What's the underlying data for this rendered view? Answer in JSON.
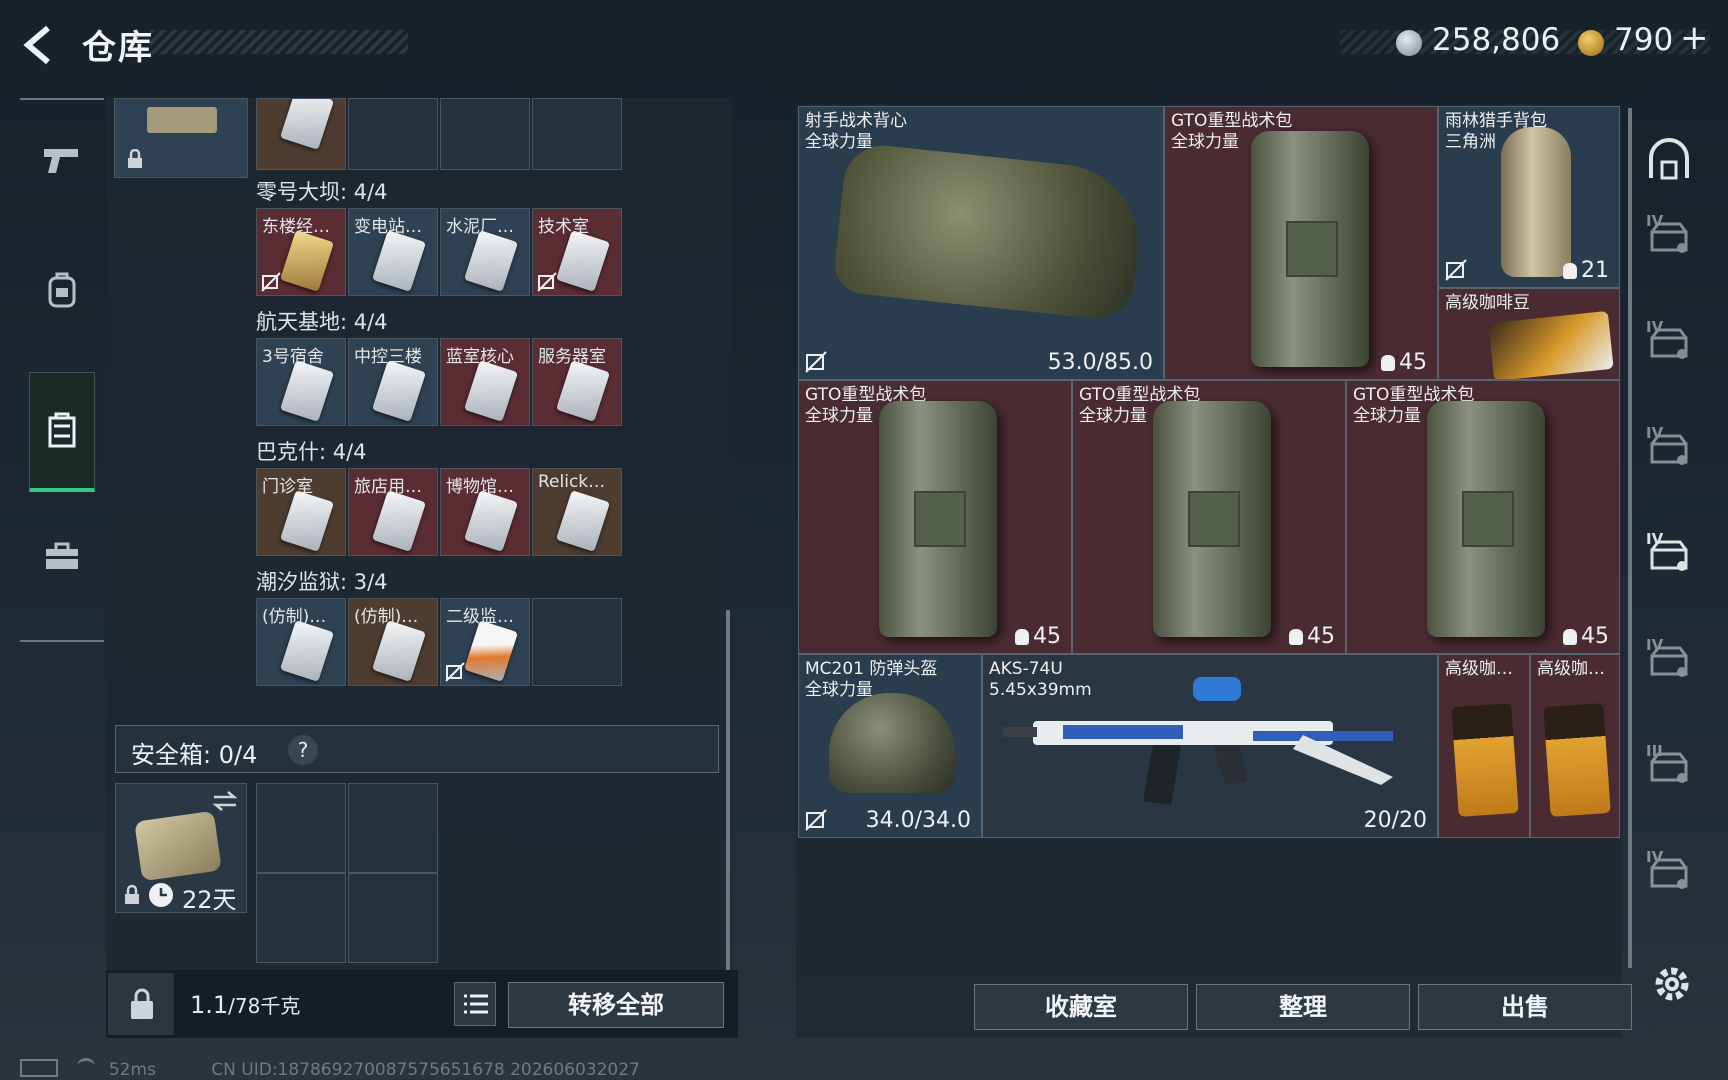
{
  "header": {
    "title": "仓库",
    "money": "258,806",
    "bonds": "790",
    "plus": "+"
  },
  "left_rail": {
    "items": [
      "weapon-tab",
      "backpack-tab",
      "container-tab",
      "toolbox-tab"
    ],
    "active": "container-tab"
  },
  "keys": {
    "groups": [
      {
        "title": "零号大坝: 4/4",
        "slots": [
          {
            "label": "东楼经…",
            "color": "red",
            "card": "gold",
            "nobind": true
          },
          {
            "label": "变电站…",
            "color": "blue",
            "card": "white",
            "nobind": false
          },
          {
            "label": "水泥厂…",
            "color": "blue",
            "card": "white",
            "nobind": false
          },
          {
            "label": "技术室",
            "color": "red",
            "card": "white",
            "nobind": true
          }
        ]
      },
      {
        "title": "航天基地: 4/4",
        "slots": [
          {
            "label": "3号宿舍",
            "color": "blue",
            "card": "white",
            "nobind": false
          },
          {
            "label": "中控三楼",
            "color": "blue",
            "card": "white",
            "nobind": false
          },
          {
            "label": "蓝室核心",
            "color": "red",
            "card": "white",
            "nobind": false
          },
          {
            "label": "服务器室",
            "color": "red",
            "card": "white",
            "nobind": false
          }
        ]
      },
      {
        "title": "巴克什: 4/4",
        "slots": [
          {
            "label": "门诊室",
            "color": "brown",
            "card": "white",
            "nobind": false
          },
          {
            "label": "旅店用…",
            "color": "red",
            "card": "white",
            "nobind": false
          },
          {
            "label": "博物馆…",
            "color": "red",
            "card": "white",
            "nobind": false
          },
          {
            "label": "Relick…",
            "color": "brown",
            "card": "white",
            "nobind": false
          }
        ]
      },
      {
        "title": "潮汐监狱: 3/4",
        "slots": [
          {
            "label": "(仿制)…",
            "color": "blue",
            "card": "white",
            "nobind": false
          },
          {
            "label": "(仿制)…",
            "color": "brown",
            "card": "white",
            "nobind": false
          },
          {
            "label": "二级监…",
            "color": "blue",
            "card": "orange",
            "nobind": true
          },
          {
            "label": "",
            "color": "empty",
            "card": "none",
            "nobind": false
          }
        ]
      }
    ]
  },
  "safe_box": {
    "label": "安全箱: 0/4",
    "help": "?",
    "days": "22天"
  },
  "bottom_left": {
    "weight_value": "1.1",
    "weight_unit": "/78千克",
    "transfer_label": "转移全部"
  },
  "status_bar": {
    "ping": "52ms",
    "uid": "CN UID:187869270087575651678 202606032027"
  },
  "items": [
    {
      "id": "vest",
      "name": "射手战术背心",
      "sub": "全球力量",
      "value": "53.0/85.0",
      "color": "blue",
      "nobind": true
    },
    {
      "id": "gto1",
      "name": "GTO重型战术包",
      "sub": "全球力量",
      "value": "45",
      "color": "red",
      "nobind": false
    },
    {
      "id": "rainforest",
      "name": "雨林猎手背包",
      "sub": "三角洲",
      "value": "21",
      "color": "blue",
      "nobind": true
    },
    {
      "id": "coffee-top",
      "name": "高级咖啡豆",
      "sub": "",
      "value": "",
      "color": "red",
      "nobind": false
    },
    {
      "id": "gto2",
      "name": "GTO重型战术包",
      "sub": "全球力量",
      "value": "45",
      "color": "red",
      "nobind": false
    },
    {
      "id": "gto3",
      "name": "GTO重型战术包",
      "sub": "全球力量",
      "value": "45",
      "color": "red",
      "nobind": false
    },
    {
      "id": "gto4",
      "name": "GTO重型战术包",
      "sub": "全球力量",
      "value": "45",
      "color": "red",
      "nobind": false
    },
    {
      "id": "helmet",
      "name": "MC201 防弹头盔",
      "sub": "全球力量",
      "value": "34.0/34.0",
      "color": "blue",
      "nobind": true
    },
    {
      "id": "rifle",
      "name": "AKS-74U",
      "sub": "5.45x39mm",
      "value": "20/20",
      "color": "dark",
      "nobind": false
    },
    {
      "id": "coffee1",
      "name": "高级咖…",
      "sub": "",
      "value": "",
      "color": "red",
      "nobind": false
    },
    {
      "id": "coffee2",
      "name": "高级咖…",
      "sub": "",
      "value": "",
      "color": "red",
      "nobind": false
    }
  ],
  "right_buttons": {
    "collection": "收藏室",
    "organize": "整理",
    "sell": "出售"
  },
  "right_rail": {
    "tiers": [
      "IV",
      "IV",
      "IV",
      "IV",
      "IV",
      "III",
      "IV"
    ],
    "active_index": 3
  },
  "colors": {
    "accent_green": "#35c58a",
    "slot_red": "#5a2c33",
    "slot_blue": "#2e4253"
  }
}
